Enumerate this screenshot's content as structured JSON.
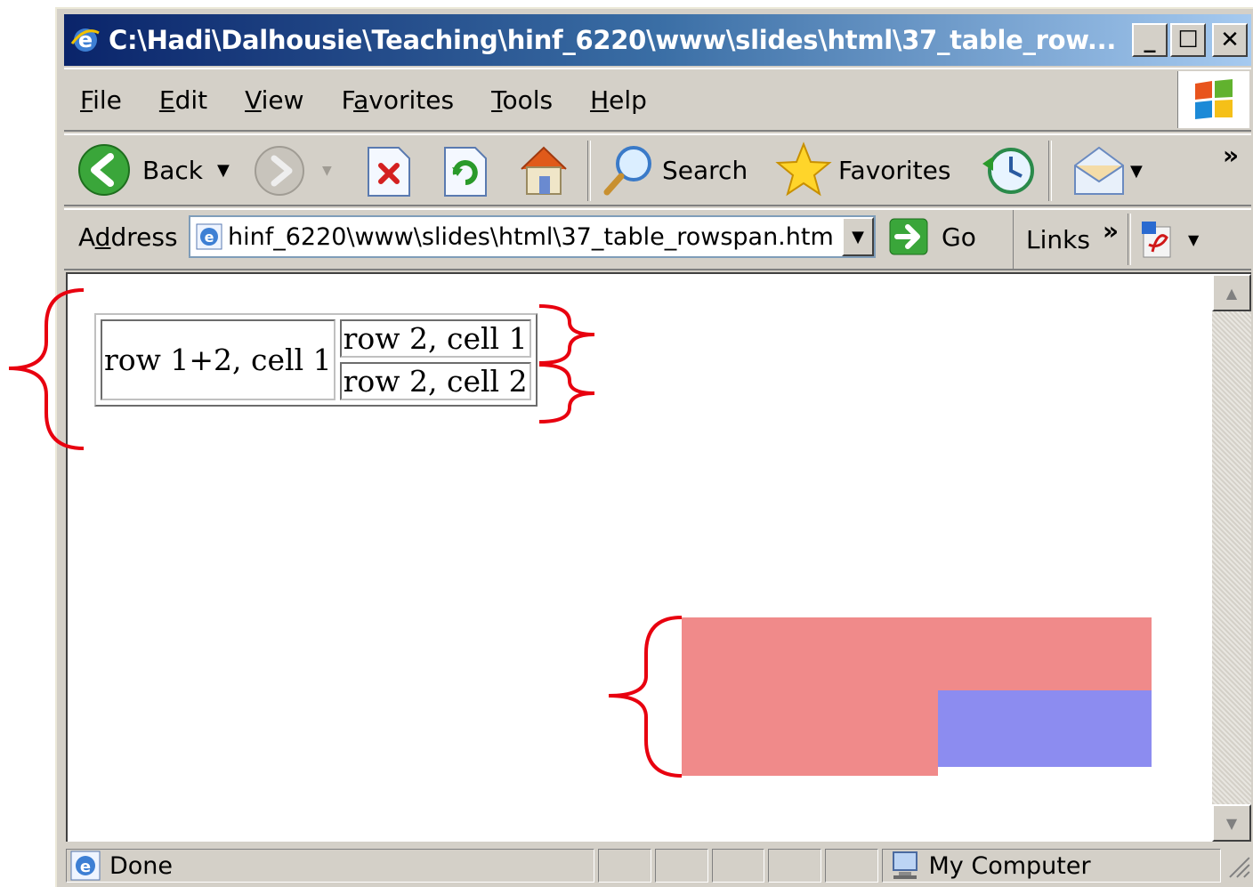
{
  "window": {
    "title": "C:\\Hadi\\Dalhousie\\Teaching\\hinf_6220\\www\\slides\\html\\37_table_row...",
    "minimize": "_",
    "maximize": "☐",
    "close": "✕"
  },
  "menu": {
    "items": [
      {
        "label_u": "F",
        "label_rest": "ile"
      },
      {
        "label_u": "E",
        "label_rest": "dit"
      },
      {
        "label_u": "V",
        "label_rest": "iew"
      },
      {
        "label_pre": "F",
        "label_u": "a",
        "label_rest": "vorites"
      },
      {
        "label_u": "T",
        "label_rest": "ools"
      },
      {
        "label_u": "H",
        "label_rest": "elp"
      }
    ]
  },
  "toolbar": {
    "back_label": "Back",
    "search_label": "Search",
    "favorites_label": "Favorites",
    "more_label": "»"
  },
  "address": {
    "label_pre": "A",
    "label_u": "d",
    "label_rest": "dress",
    "value": "hinf_6220\\www\\slides\\html\\37_table_rowspan.htm",
    "go_label": "Go",
    "links_label": "Links",
    "links_more": "»"
  },
  "table": {
    "cell_span": "row 1+2, cell 1",
    "cell_r1": "row 2, cell 1",
    "cell_r2": "row 2, cell 2"
  },
  "status": {
    "text": "Done",
    "zone": "My Computer"
  },
  "colors": {
    "annotation": "#e8000f",
    "block_red": "#f08a8a",
    "block_blue": "#8c8cf0"
  }
}
